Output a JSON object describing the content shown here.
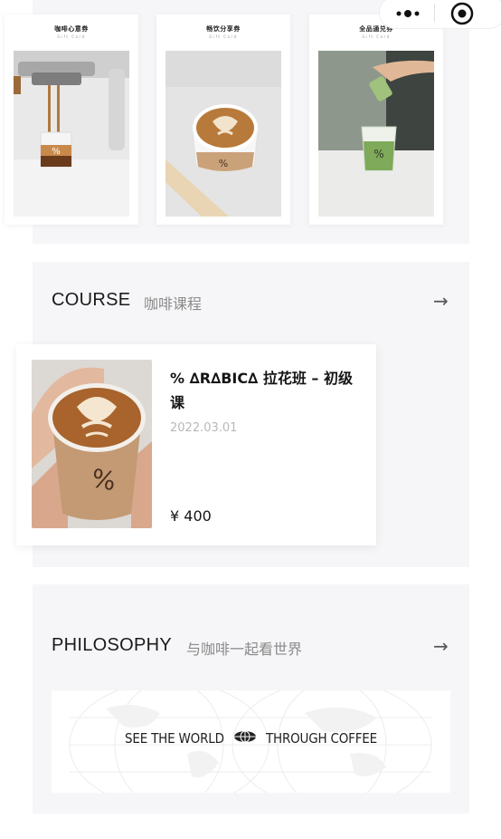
{
  "gift_cards": [
    {
      "title": "咖啡心意券",
      "subtitle": "Gift Card"
    },
    {
      "title": "畅饮分享券",
      "subtitle": "Gift Card"
    },
    {
      "title": "全品通兑券",
      "subtitle": "Gift Card"
    }
  ],
  "course": {
    "title": "COURSE",
    "subtitle": "咖啡课程",
    "arrow": "→",
    "item": {
      "name": "% ∆R∆BIC∆ 拉花班 – 初级课",
      "date": "2022.03.01",
      "price": "¥ 400"
    }
  },
  "philosophy": {
    "title": "PHILOSOPHY",
    "subtitle": "与咖啡一起看世界",
    "arrow": "→",
    "banner_left": "SEE THE WORLD",
    "banner_right": "THROUGH COFFEE"
  },
  "capsule": {
    "menu_icon": "more-dots-icon",
    "close_icon": "target-close-icon"
  },
  "colors": {
    "panel_bg": "#f6f6f8",
    "text": "#1a1a1a",
    "muted": "#8a8a8a",
    "date": "#b8b8b8"
  }
}
